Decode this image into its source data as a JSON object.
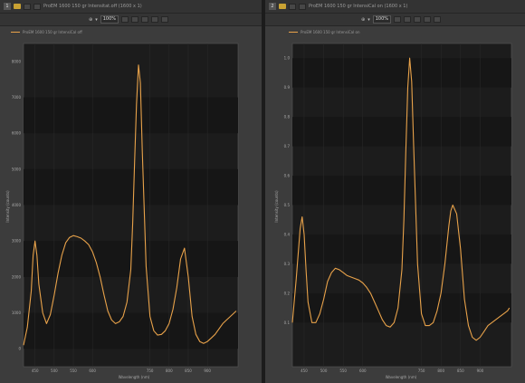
{
  "colors": {
    "spectrum": "#e8a24a",
    "plot_bg": "#1c1c1c",
    "band_alt": "#161616"
  },
  "panels": [
    {
      "index": "1",
      "title": "ProEM 1600 150 gr Intensitat.off   (1600 x 1)",
      "zoom": "100%",
      "legend": "ProEM 1600 150 gr IntensiCal off",
      "xlabel": "Wavelength (nm)",
      "ylabel": "Intensity (counts)"
    },
    {
      "index": "2",
      "title": "ProEM 1600 150 gr IntensiCal on   (1600 x 1)",
      "zoom": "100%",
      "legend": "ProEM 1600 150 gr IntensiCal on",
      "xlabel": "Wavelength (nm)",
      "ylabel": "Intensity (counts)"
    }
  ],
  "chart_data": [
    {
      "type": "line",
      "xlabel": "Wavelength (nm)",
      "ylabel": "Intensity (counts)",
      "xlim": [
        420,
        980
      ],
      "ylim": [
        -500,
        8500
      ],
      "x_ticks": [
        450,
        500,
        550,
        600,
        750,
        800,
        850,
        900
      ],
      "x_tick_labels": [
        "450",
        "500",
        "550",
        "600",
        "750",
        "800",
        "850",
        "900"
      ],
      "y_ticks": [
        0,
        1000,
        2000,
        3000,
        4000,
        5000,
        6000,
        7000,
        8000
      ],
      "y_tick_labels": [
        "0",
        "1000",
        "2000",
        "3000",
        "4000",
        "5000",
        "6000",
        "7000",
        "8000"
      ],
      "series": [
        {
          "name": "ProEM 1600 150 gr IntensiCal off",
          "x": [
            420,
            430,
            440,
            445,
            450,
            455,
            460,
            470,
            480,
            490,
            500,
            510,
            520,
            530,
            540,
            550,
            560,
            570,
            580,
            590,
            600,
            610,
            620,
            630,
            640,
            650,
            660,
            670,
            680,
            690,
            700,
            705,
            710,
            715,
            720,
            725,
            730,
            740,
            750,
            760,
            770,
            780,
            790,
            800,
            810,
            820,
            830,
            840,
            850,
            860,
            870,
            880,
            890,
            900,
            910,
            920,
            930,
            940,
            950,
            960,
            970,
            975
          ],
          "y": [
            100,
            600,
            1600,
            2600,
            3000,
            2600,
            1800,
            1000,
            700,
            950,
            1500,
            2100,
            2600,
            2950,
            3100,
            3150,
            3120,
            3080,
            3000,
            2900,
            2700,
            2400,
            2000,
            1500,
            1050,
            800,
            700,
            750,
            900,
            1300,
            2200,
            3500,
            5200,
            6800,
            7900,
            7400,
            5500,
            2300,
            900,
            500,
            380,
            400,
            500,
            700,
            1100,
            1700,
            2500,
            2800,
            2000,
            900,
            400,
            200,
            150,
            200,
            300,
            400,
            550,
            700,
            800,
            900,
            1000,
            1050
          ]
        }
      ]
    },
    {
      "type": "line",
      "xlabel": "Wavelength (nm)",
      "ylabel": "Intensity (counts)",
      "xlim": [
        420,
        980
      ],
      "ylim": [
        -0.05,
        1.05
      ],
      "x_ticks": [
        450,
        500,
        550,
        600,
        750,
        800,
        850,
        900
      ],
      "x_tick_labels": [
        "450",
        "500",
        "550",
        "600",
        "750",
        "800",
        "850",
        "900"
      ],
      "y_ticks": [
        0.1,
        0.2,
        0.3,
        0.4,
        0.5,
        0.6,
        0.7,
        0.8,
        0.9,
        1.0
      ],
      "y_tick_labels": [
        "0.1",
        "0.2",
        "0.3",
        "0.4",
        "0.5",
        "0.6",
        "0.7",
        "0.8",
        "0.9",
        "1.0"
      ],
      "series": [
        {
          "name": "ProEM 1600 150 gr IntensiCal on",
          "x": [
            420,
            430,
            440,
            445,
            450,
            455,
            460,
            470,
            480,
            490,
            500,
            510,
            520,
            530,
            540,
            550,
            560,
            570,
            580,
            590,
            600,
            610,
            620,
            630,
            640,
            650,
            660,
            670,
            680,
            690,
            700,
            705,
            710,
            715,
            720,
            725,
            730,
            740,
            750,
            760,
            770,
            780,
            790,
            800,
            810,
            820,
            825,
            830,
            840,
            850,
            860,
            870,
            880,
            890,
            900,
            910,
            920,
            930,
            940,
            950,
            960,
            970,
            975
          ],
          "y": [
            0.1,
            0.25,
            0.42,
            0.46,
            0.4,
            0.28,
            0.17,
            0.1,
            0.1,
            0.13,
            0.18,
            0.24,
            0.27,
            0.285,
            0.28,
            0.27,
            0.26,
            0.255,
            0.25,
            0.245,
            0.235,
            0.22,
            0.2,
            0.17,
            0.14,
            0.11,
            0.09,
            0.085,
            0.1,
            0.15,
            0.28,
            0.45,
            0.68,
            0.9,
            1.0,
            0.92,
            0.7,
            0.3,
            0.13,
            0.09,
            0.09,
            0.1,
            0.14,
            0.2,
            0.3,
            0.43,
            0.48,
            0.5,
            0.47,
            0.35,
            0.18,
            0.09,
            0.05,
            0.04,
            0.05,
            0.07,
            0.09,
            0.1,
            0.11,
            0.12,
            0.13,
            0.14,
            0.15
          ]
        }
      ]
    }
  ]
}
